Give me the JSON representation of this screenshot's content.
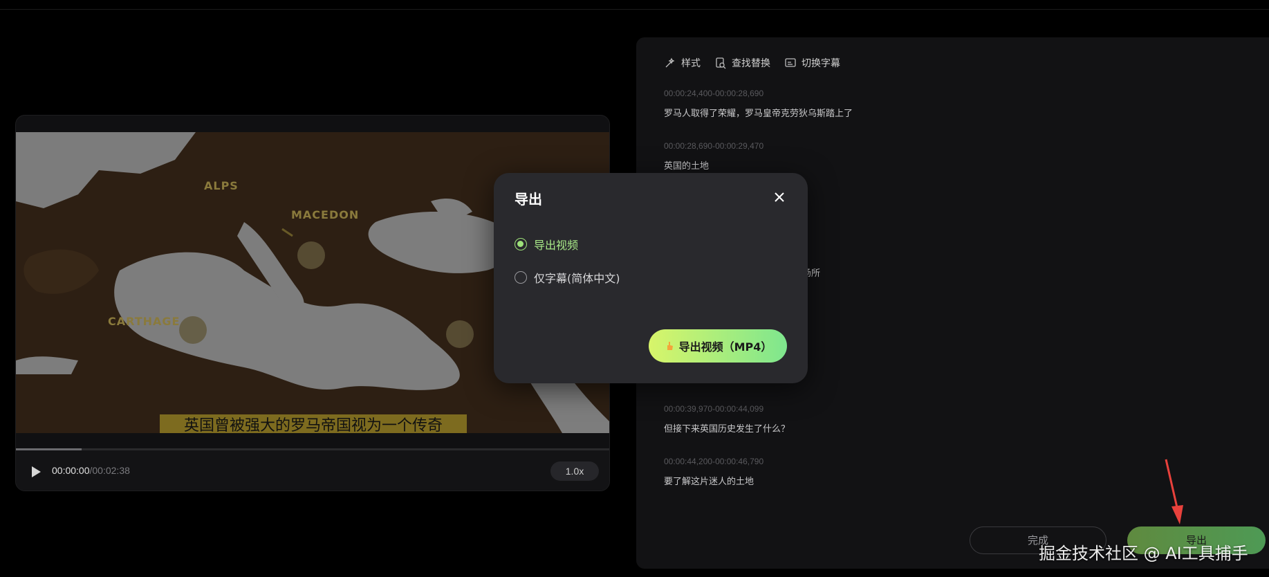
{
  "player": {
    "subtitle": "英国曾被强大的罗马帝国视为一个传奇",
    "map_labels": [
      "ALPS",
      "MACEDON",
      "CARTHAGE"
    ],
    "current_time": "00:00:00",
    "duration": "/00:02:38",
    "speed": "1.0x",
    "progress": 0.11
  },
  "toolbar": {
    "style": "样式",
    "find_replace": "查找替换",
    "switch_subtitle": "切换字幕"
  },
  "cues": [
    {
      "time": "00:00:24,400-00:00:28,690",
      "text": "罗马人取得了荣耀，罗马皇帝克劳狄乌斯踏上了"
    },
    {
      "time": "00:00:28,690-00:00:29,470",
      "text": "英国的土地"
    },
    {
      "time": "",
      "text": "场所"
    },
    {
      "time": "00:00:39,970-00:00:44,099",
      "text": "但接下来英国历史发生了什么？"
    },
    {
      "time": "00:00:44,200-00:00:46,790",
      "text": "要了解这片迷人的土地"
    }
  ],
  "footer": {
    "done": "完成",
    "export": "导出"
  },
  "modal": {
    "title": "导出",
    "option_video": "导出视频",
    "option_subtitle": "仅字幕(简体中文)",
    "export_button": "导出视频（MP4）"
  },
  "watermark": "掘金技术社区 @ AI工具捕手",
  "colors": {
    "accent_green": "#9ee27a",
    "export_gradient_start": "#d8f56a",
    "export_gradient_end": "#7ee68e",
    "arrow": "#e8413c"
  }
}
